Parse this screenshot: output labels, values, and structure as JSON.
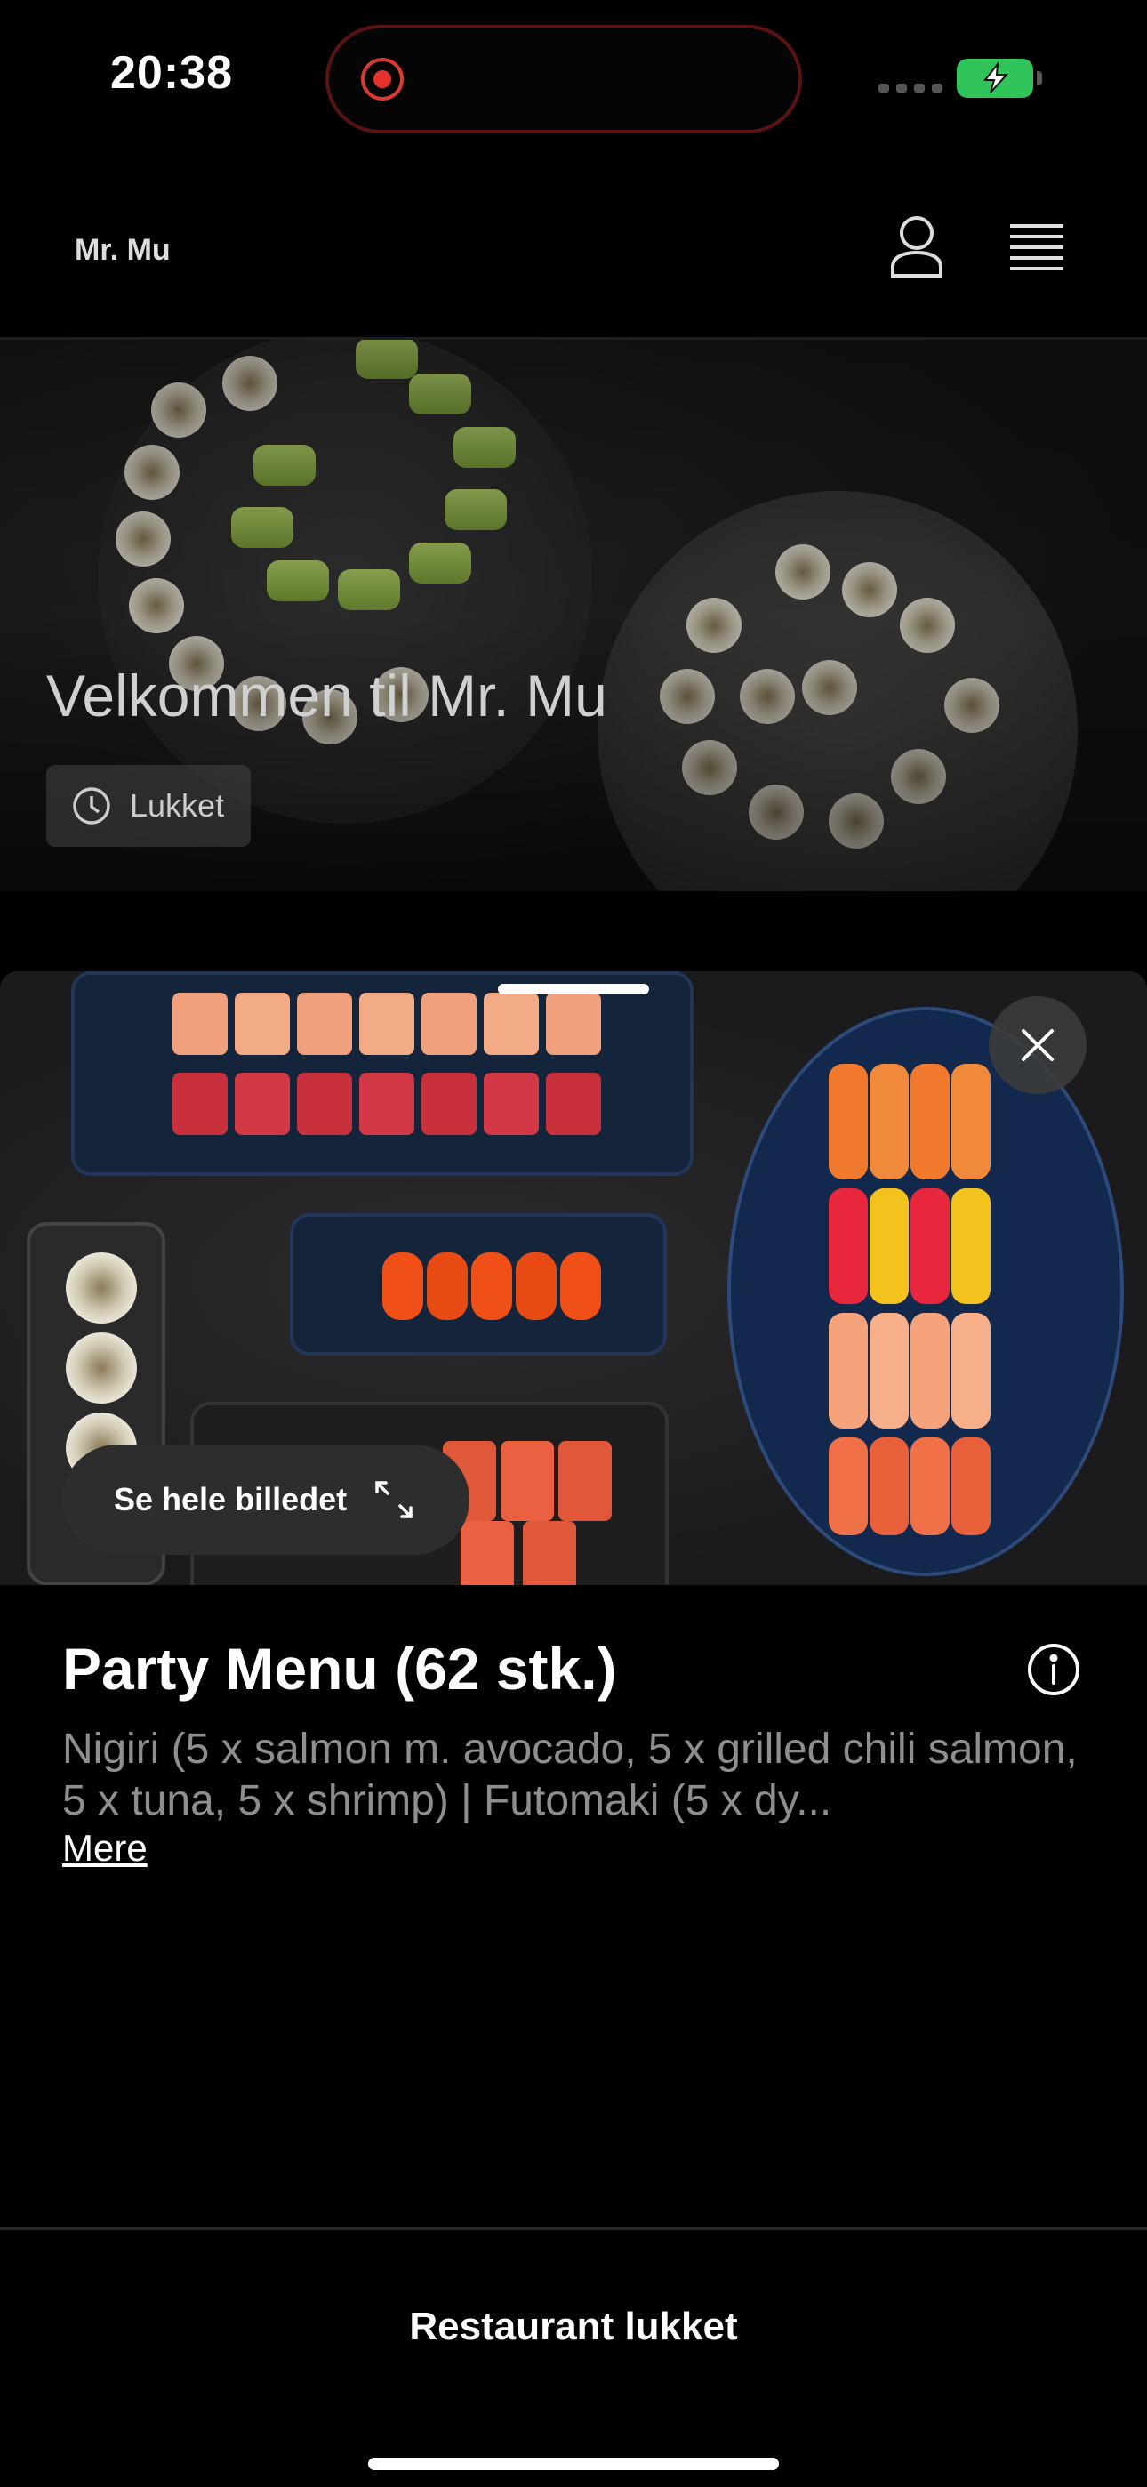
{
  "status_bar": {
    "time": "20:38"
  },
  "header": {
    "brand": "Mr. Mu"
  },
  "hero": {
    "title": "Velkommen til Mr. Mu",
    "status_label": "Lukket"
  },
  "product": {
    "image_button_label": "Se hele billedet",
    "title": "Party Menu (62 stk.)",
    "description": "Nigiri (5 x salmon m. avocado, 5 x grilled chili salmon, 5 x tuna, 5 x shrimp) | Futomaki (5 x dy...",
    "more_label": "Mere"
  },
  "footer": {
    "label": "Restaurant lukket"
  },
  "icons": {
    "profile": "user-icon",
    "menu": "hamburger-menu-icon",
    "clock": "clock-icon",
    "close": "close-icon",
    "expand": "expand-icon",
    "info": "info-icon"
  },
  "colors": {
    "background": "#000000",
    "muted_text": "#8e8e8e",
    "battery": "#30c35a",
    "recording": "#e5322c"
  }
}
